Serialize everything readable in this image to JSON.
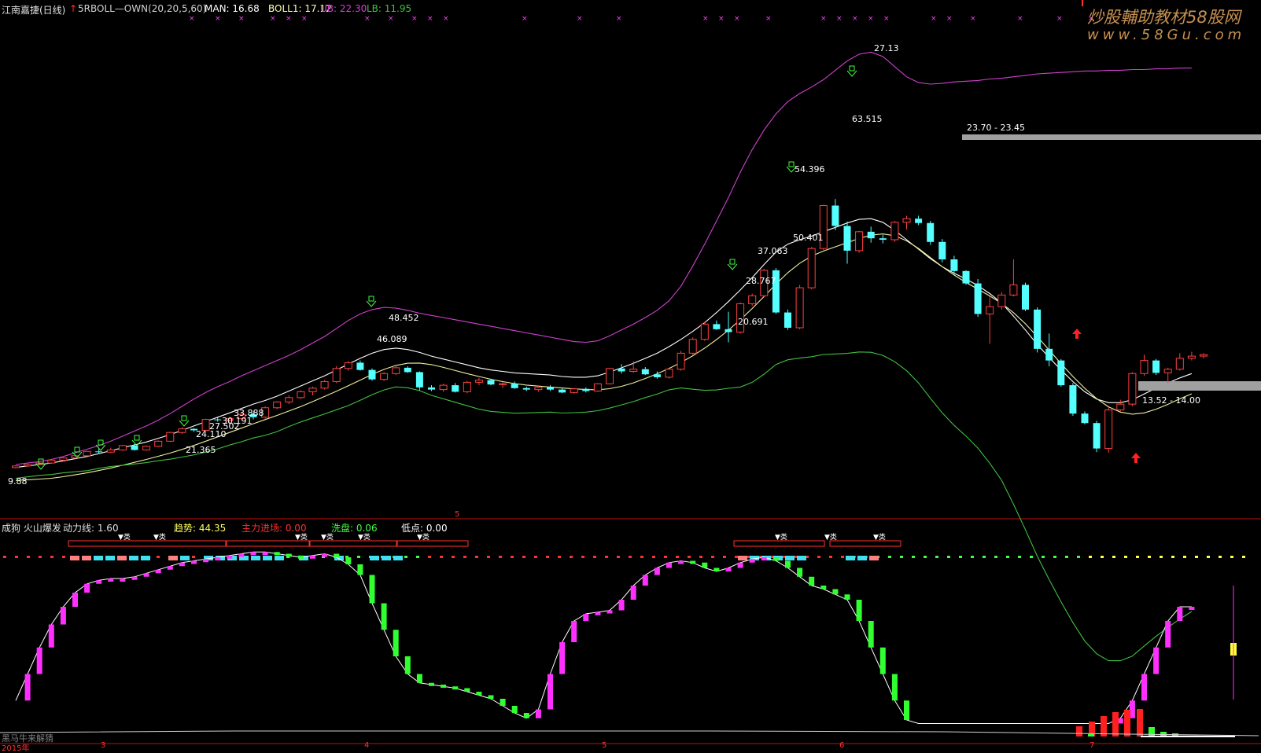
{
  "header": {
    "stock_name": "江南嘉捷(日线)",
    "indicator_name": "5RBOLL—OWN(20,20,5,60)",
    "man": "MAN: 16.68",
    "boll1": "BOLL1: 17.12",
    "ub": "UB: 22.30",
    "lb": "LB: 11.95"
  },
  "watermark": {
    "line1": "炒股輔助教材58股网",
    "line2": "www.58Gu.com"
  },
  "lower_header": {
    "name": "成狗 火山爆发",
    "power_line": "动力线: 1.60",
    "trend": "趋势: 44.35",
    "main_force": "主力进场: 0.00",
    "wash": "洗盘: 0.06",
    "low_point": "低点: 0.00"
  },
  "separator_digit": "5",
  "bottom_left": "黑马牛来解猜",
  "year_label": "2015年",
  "month_labels": [
    "3",
    "4",
    "5",
    "6",
    "7"
  ],
  "zone_labels": [
    "23.70 - 23.45",
    "13.52 - 14.00"
  ],
  "annotations": [
    "9.88",
    "21.365",
    "24.110",
    "27.502",
    "30.191",
    "33.888",
    "46.089",
    "48.452",
    "20.691",
    "28.767",
    "37.063",
    "50.401",
    "54.396",
    "63.515",
    "27.13"
  ],
  "colors": {
    "up": "#ff4040",
    "down": "#54ffff",
    "upper_band": "#d040d0",
    "mid_band": "#ffffff",
    "ma_line": "#f0f0a0",
    "lower_band": "#40c040",
    "zone_bar": "#a0a0a0",
    "magenta_bar": "#ff30ff",
    "green_bar": "#30ff30",
    "red_bar": "#ff2020",
    "yellow_bar": "#ffff30"
  },
  "chart_data": [
    {
      "type": "candlestick",
      "title": "5RBOLL—OWN(20,20,5,60)",
      "candles_ohlc": [
        [
          9.88,
          10.2,
          9.8,
          10.1
        ],
        [
          10.1,
          10.4,
          10.0,
          10.3
        ],
        [
          10.3,
          10.6,
          10.2,
          10.5
        ],
        [
          10.5,
          11.0,
          10.4,
          10.9
        ],
        [
          10.9,
          11.3,
          10.8,
          11.2
        ],
        [
          11.2,
          11.6,
          11.1,
          11.5
        ],
        [
          11.5,
          12.2,
          11.4,
          12.1
        ],
        [
          12.1,
          12.5,
          11.8,
          12.0
        ],
        [
          12.0,
          12.6,
          11.9,
          12.3
        ],
        [
          12.3,
          13.0,
          12.2,
          12.9
        ],
        [
          12.9,
          13.1,
          12.2,
          12.3
        ],
        [
          12.3,
          12.9,
          12.2,
          12.8
        ],
        [
          12.8,
          13.6,
          12.7,
          13.5
        ],
        [
          13.5,
          14.8,
          13.4,
          14.7
        ],
        [
          14.7,
          15.4,
          14.5,
          15.2
        ],
        [
          15.2,
          15.3,
          14.8,
          15.0
        ],
        [
          15.0,
          16.6,
          14.9,
          16.5
        ],
        [
          16.5,
          16.8,
          16.2,
          16.4
        ],
        [
          16.4,
          16.8,
          16.0,
          16.6
        ],
        [
          16.6,
          17.5,
          16.5,
          17.2
        ],
        [
          17.2,
          17.6,
          16.5,
          16.8
        ],
        [
          16.8,
          18.3,
          16.6,
          18.1
        ],
        [
          18.1,
          19.0,
          17.9,
          18.9
        ],
        [
          18.9,
          19.8,
          18.6,
          19.5
        ],
        [
          19.5,
          20.5,
          19.3,
          20.3
        ],
        [
          20.3,
          21.0,
          19.8,
          20.8
        ],
        [
          20.8,
          21.9,
          20.6,
          21.7
        ],
        [
          21.7,
          23.8,
          21.5,
          23.5
        ],
        [
          23.5,
          24.5,
          23.2,
          24.3
        ],
        [
          24.3,
          24.6,
          23.2,
          23.3
        ],
        [
          23.3,
          23.5,
          21.8,
          22.0
        ],
        [
          22.0,
          23.0,
          21.8,
          22.8
        ],
        [
          22.8,
          23.8,
          22.6,
          23.6
        ],
        [
          23.6,
          23.8,
          22.9,
          23.0
        ],
        [
          23.0,
          23.1,
          20.5,
          20.9
        ],
        [
          20.9,
          21.2,
          20.4,
          20.6
        ],
        [
          20.6,
          21.4,
          20.3,
          21.2
        ],
        [
          21.2,
          21.5,
          20.2,
          20.3
        ],
        [
          20.3,
          21.8,
          20.1,
          21.6
        ],
        [
          21.6,
          22.2,
          21.2,
          21.9
        ],
        [
          21.9,
          22.1,
          21.2,
          21.3
        ],
        [
          21.3,
          21.6,
          20.8,
          21.4
        ],
        [
          21.4,
          21.7,
          20.7,
          20.8
        ],
        [
          20.8,
          21.0,
          20.4,
          20.6
        ],
        [
          20.6,
          21.1,
          20.3,
          20.9
        ],
        [
          20.9,
          21.2,
          20.4,
          20.6
        ],
        [
          20.6,
          20.8,
          20.1,
          20.2
        ],
        [
          20.2,
          20.8,
          20.0,
          20.7
        ],
        [
          20.7,
          20.9,
          20.2,
          20.4
        ],
        [
          20.4,
          21.5,
          20.3,
          21.4
        ],
        [
          21.4,
          23.6,
          21.3,
          23.5
        ],
        [
          23.5,
          24.1,
          22.8,
          23.1
        ],
        [
          23.1,
          24.5,
          22.9,
          23.4
        ],
        [
          23.4,
          23.7,
          22.6,
          22.7
        ],
        [
          22.7,
          23.1,
          22.1,
          22.3
        ],
        [
          22.3,
          23.6,
          22.1,
          23.4
        ],
        [
          23.4,
          25.9,
          23.2,
          25.6
        ],
        [
          25.6,
          27.8,
          25.4,
          27.5
        ],
        [
          27.5,
          29.9,
          27.3,
          29.6
        ],
        [
          29.6,
          30.1,
          28.8,
          28.9
        ],
        [
          28.9,
          31.3,
          27.1,
          28.5
        ],
        [
          28.5,
          32.6,
          28.3,
          32.4
        ],
        [
          32.4,
          33.8,
          32.1,
          33.5
        ],
        [
          33.5,
          37.2,
          33.3,
          37.0
        ],
        [
          37.0,
          37.3,
          31.0,
          31.2
        ],
        [
          31.2,
          31.6,
          28.8,
          29.1
        ],
        [
          29.1,
          35.0,
          28.9,
          34.6
        ],
        [
          34.6,
          40.2,
          34.4,
          40.0
        ],
        [
          40.0,
          46.0,
          39.8,
          45.9
        ],
        [
          45.9,
          46.8,
          42.5,
          43.1
        ],
        [
          43.1,
          43.7,
          37.9,
          39.7
        ],
        [
          39.7,
          42.4,
          39.4,
          42.3
        ],
        [
          42.3,
          43.0,
          40.8,
          41.4
        ],
        [
          41.4,
          41.9,
          40.7,
          41.2
        ],
        [
          41.2,
          43.8,
          40.9,
          43.6
        ],
        [
          43.6,
          44.5,
          42.6,
          44.1
        ],
        [
          44.1,
          44.5,
          43.2,
          43.5
        ],
        [
          43.5,
          43.8,
          40.5,
          40.9
        ],
        [
          40.9,
          41.3,
          38.1,
          38.5
        ],
        [
          38.5,
          39.0,
          36.4,
          36.9
        ],
        [
          36.9,
          37.0,
          35.0,
          35.2
        ],
        [
          35.2,
          35.8,
          30.6,
          31.0
        ],
        [
          31.0,
          33.4,
          26.9,
          32.0
        ],
        [
          32.0,
          34.0,
          31.6,
          33.6
        ],
        [
          33.6,
          38.5,
          33.4,
          35.0
        ],
        [
          35.0,
          35.3,
          31.4,
          31.6
        ],
        [
          31.6,
          31.9,
          25.7,
          26.2
        ],
        [
          26.2,
          28.3,
          23.8,
          24.6
        ],
        [
          24.6,
          24.8,
          21.0,
          21.2
        ],
        [
          21.2,
          21.5,
          17.0,
          17.3
        ],
        [
          17.3,
          17.6,
          15.8,
          16.0
        ],
        [
          16.0,
          16.3,
          12.0,
          12.5
        ],
        [
          12.5,
          18.2,
          11.9,
          17.8
        ],
        [
          17.8,
          19.2,
          17.6,
          18.6
        ],
        [
          18.6,
          23.0,
          18.3,
          22.8
        ],
        [
          22.8,
          25.4,
          22.5,
          24.6
        ],
        [
          24.6,
          24.8,
          22.6,
          22.9
        ],
        [
          22.9,
          23.6,
          21.5,
          23.4
        ],
        [
          23.4,
          25.6,
          23.2,
          24.9
        ],
        [
          24.9,
          25.8,
          24.6,
          25.2
        ],
        [
          25.2,
          25.6,
          24.9,
          25.4
        ]
      ],
      "levels": {
        "man": 16.68,
        "boll1": 17.12,
        "ub": 22.3,
        "lb": 11.95
      },
      "bands": {
        "upper": [
          10.3,
          10.5,
          10.7,
          11.0,
          11.4,
          11.9,
          12.4,
          12.9,
          13.5,
          14.2,
          14.9,
          15.6,
          16.4,
          17.3,
          18.3,
          19.3,
          20.2,
          21.0,
          21.7,
          22.5,
          23.2,
          23.9,
          24.6,
          25.3,
          26.1,
          27.0,
          27.9,
          29.0,
          30.1,
          31.0,
          31.6,
          31.9,
          31.8,
          31.5,
          31.1,
          30.8,
          30.5,
          30.2,
          29.9,
          29.6,
          29.3,
          29.0,
          28.7,
          28.4,
          28.1,
          27.8,
          27.5,
          27.2,
          27.1,
          27.3,
          28.0,
          28.8,
          29.6,
          30.5,
          31.5,
          32.8,
          34.8,
          37.6,
          40.6,
          43.8,
          47.0,
          50.5,
          53.6,
          56.3,
          58.5,
          60.2,
          61.3,
          62.2,
          63.2,
          64.5,
          65.8,
          66.7,
          67.0,
          66.4,
          65.0,
          63.6,
          62.8,
          62.6,
          62.7,
          62.9,
          63.0,
          63.1,
          63.3,
          63.4,
          63.6,
          63.8,
          64.0,
          64.1,
          64.2,
          64.3,
          64.4,
          64.4,
          64.5,
          64.5,
          64.6,
          64.6,
          64.7,
          64.7,
          64.8,
          64.8
        ],
        "middle": [
          9.9,
          10.1,
          10.3,
          10.5,
          10.8,
          11.1,
          11.4,
          11.8,
          12.2,
          12.6,
          13.0,
          13.4,
          13.9,
          14.4,
          15.0,
          15.6,
          16.2,
          16.8,
          17.4,
          18.0,
          18.6,
          19.1,
          19.7,
          20.4,
          21.1,
          21.8,
          22.5,
          23.3,
          24.1,
          24.9,
          25.6,
          26.1,
          26.3,
          26.1,
          25.7,
          25.2,
          24.8,
          24.4,
          24.0,
          23.6,
          23.3,
          23.1,
          22.9,
          22.8,
          22.7,
          22.6,
          22.4,
          22.3,
          22.3,
          22.5,
          23.0,
          23.6,
          24.2,
          24.9,
          25.6,
          26.5,
          27.5,
          28.6,
          29.8,
          31.2,
          32.7,
          34.3,
          36.0,
          37.8,
          39.5,
          40.6,
          41.2,
          41.7,
          42.3,
          42.9,
          43.5,
          44.0,
          44.1,
          43.6,
          42.5,
          41.2,
          39.9,
          38.6,
          37.5,
          36.6,
          35.8,
          34.9,
          33.8,
          32.5,
          30.7,
          28.8,
          26.8,
          25.0,
          23.3,
          21.7,
          20.3,
          19.3,
          18.8,
          18.8,
          19.2,
          20.0,
          20.8,
          21.5,
          22.2,
          22.8
        ]
      }
    },
    {
      "type": "bar",
      "title": "成狗 火山爆发",
      "power_line": 1.6,
      "trend": 44.35,
      "main_force": 0.0,
      "wash": 0.06,
      "low_point": 0.0
    }
  ]
}
